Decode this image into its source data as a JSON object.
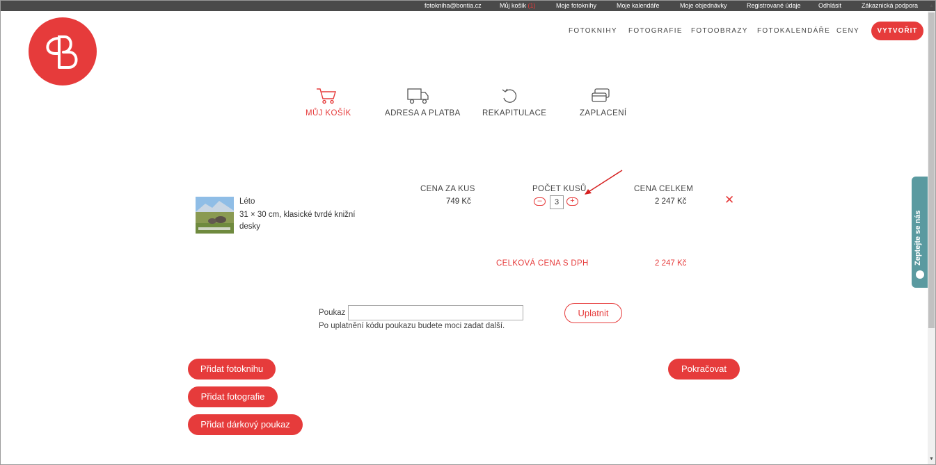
{
  "topbar": {
    "email": "fotokniha@bontia.cz",
    "cart_label": "Můj košík",
    "cart_count": "(1)",
    "links": [
      "Moje fotoknihy",
      "Moje kalendáře",
      "Moje objednávky",
      "Registrované údaje",
      "Odhlásit",
      "Zákaznická podpora"
    ]
  },
  "nav": {
    "items": [
      "FOTOKNIHY",
      "FOTOGRAFIE",
      "FOTOOBRAZY",
      "FOTOKALENDÁŘE",
      "CENY"
    ],
    "create_label": "VYTVOŘIT"
  },
  "steps": [
    {
      "label": "MŮJ KOŠÍK",
      "icon": "cart-icon",
      "active": true
    },
    {
      "label": "ADRESA A PLATBA",
      "icon": "truck-icon",
      "active": false
    },
    {
      "label": "REKAPITULACE",
      "icon": "refresh-icon",
      "active": false
    },
    {
      "label": "ZAPLACENÍ",
      "icon": "card-icon",
      "active": false
    }
  ],
  "cart": {
    "headers": {
      "unit_price": "CENA ZA KUS",
      "quantity": "POČET KUSŮ",
      "total": "CENA CELKEM"
    },
    "item": {
      "name": "Léto",
      "description": "31 × 30 cm, klasické tvrdé knižní desky",
      "unit_price": "749 Kč",
      "quantity": "3",
      "total": "2 247 Kč"
    },
    "grand_total_label": "CELKOVÁ CENA S DPH",
    "grand_total_value": "2 247 Kč"
  },
  "voucher": {
    "label": "Poukaz",
    "value": "",
    "apply_label": "Uplatnit",
    "note": "Po uplatnění kódu poukazu budete moci zadat další."
  },
  "actions": {
    "add_photobook": "Přidat fotoknihu",
    "add_photos": "Přidat fotografie",
    "add_voucher": "Přidat dárkový poukaz",
    "continue": "Pokračovat"
  },
  "side_widget": {
    "label": "Zeptejte se nás"
  },
  "colors": {
    "accent": "#e63b3b",
    "topbar": "#4a4a4a",
    "widget": "#5a9aa0"
  }
}
